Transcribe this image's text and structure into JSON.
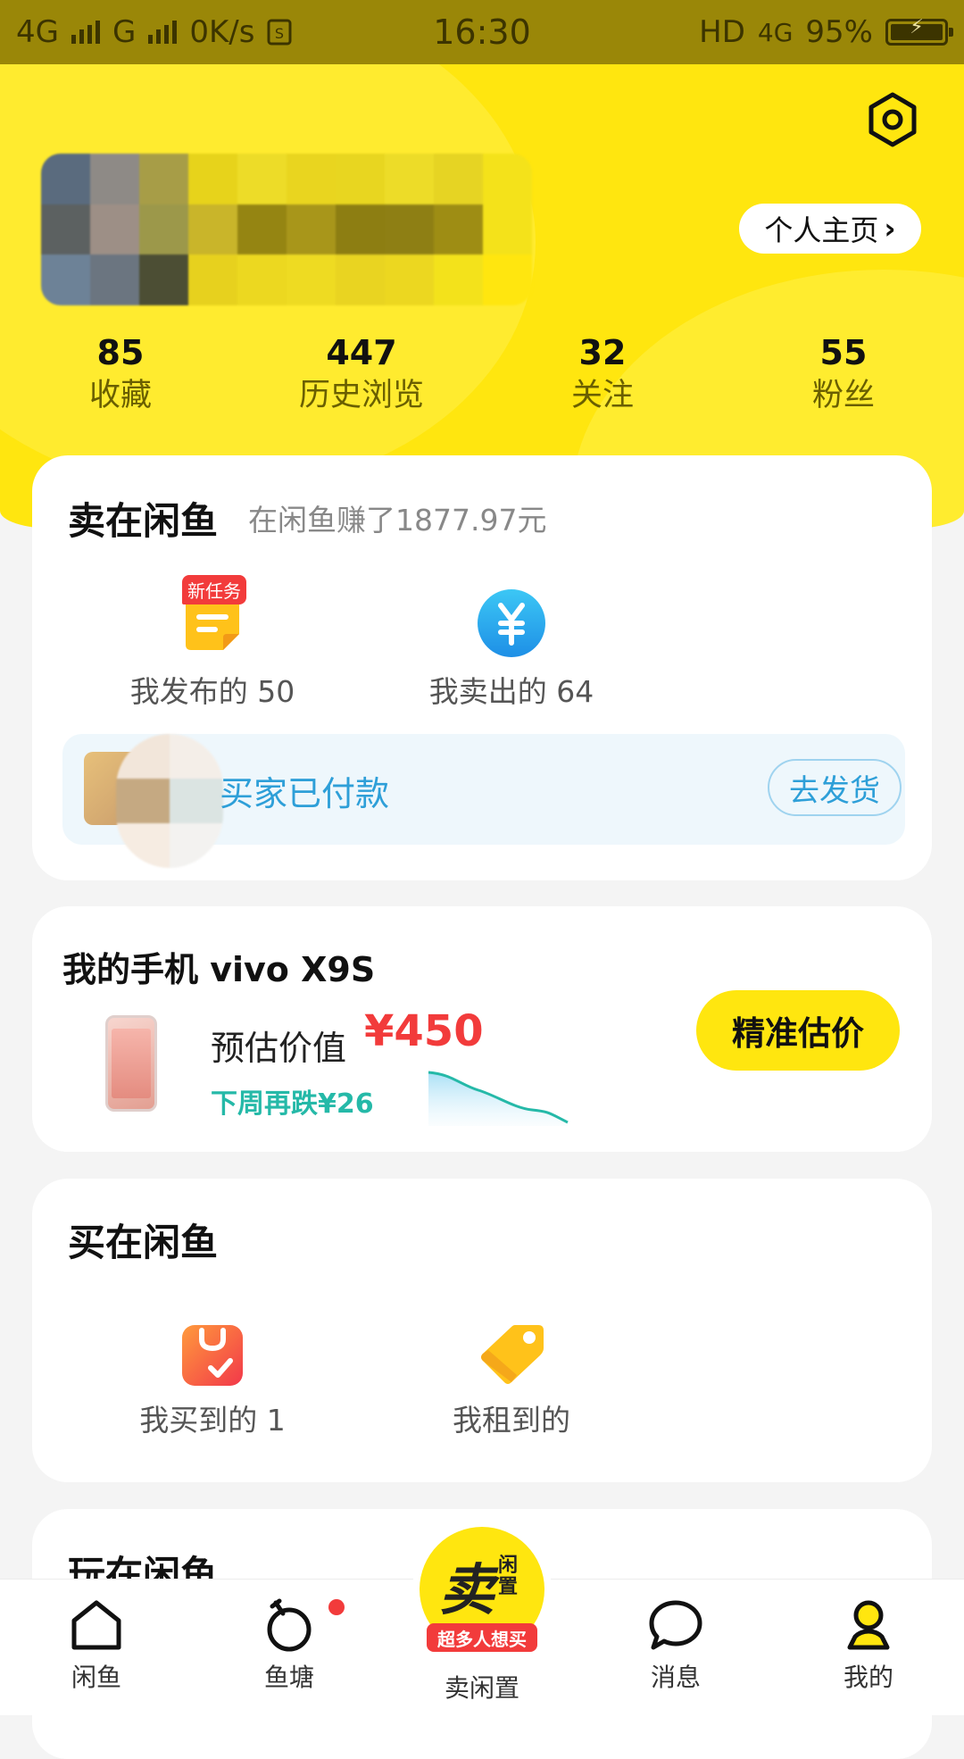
{
  "status_bar": {
    "network_left": "4G",
    "network_mid": "G",
    "speed": "0K/s",
    "time": "16:30",
    "hd": "HD",
    "network_right": "4G",
    "battery": "95%"
  },
  "header": {
    "profile_button": "个人主页",
    "stats": [
      {
        "value": "85",
        "label": "收藏"
      },
      {
        "value": "447",
        "label": "历史浏览"
      },
      {
        "value": "32",
        "label": "关注"
      },
      {
        "value": "55",
        "label": "粉丝"
      }
    ]
  },
  "sell_section": {
    "title": "卖在闲鱼",
    "subtitle": "在闲鱼赚了1877.97元",
    "badge": "新任务",
    "items": [
      {
        "label": "我发布的 50",
        "icon": "published-note-icon"
      },
      {
        "label": "我卖出的 64",
        "icon": "yuan-icon"
      }
    ],
    "notice": {
      "text": "买家已付款",
      "button": "去发货"
    }
  },
  "phone_section": {
    "title": "我的手机 vivo X9S",
    "estimate_label": "预估价值",
    "price": "¥450",
    "trend": "下周再跌¥26",
    "button": "精准估价"
  },
  "buy_section": {
    "title": "买在闲鱼",
    "items": [
      {
        "label": "我买到的 1",
        "icon": "shopping-bag-icon"
      },
      {
        "label": "我租到的",
        "icon": "tag-icon"
      }
    ]
  },
  "play_section": {
    "title": "玩在闲鱼"
  },
  "tab_bar": {
    "tabs": [
      {
        "label": "闲鱼"
      },
      {
        "label": "鱼塘"
      },
      {
        "label": "卖闲置"
      },
      {
        "label": "消息"
      },
      {
        "label": "我的"
      }
    ],
    "sell_big": "卖",
    "sell_small": "闲置",
    "sell_ribbon": "超多人想买"
  },
  "colors": {
    "brand_yellow": "#ffe60f",
    "price_red": "#f23b3b",
    "trend_teal": "#25b9a8",
    "notice_blue": "#2e9fd8"
  }
}
